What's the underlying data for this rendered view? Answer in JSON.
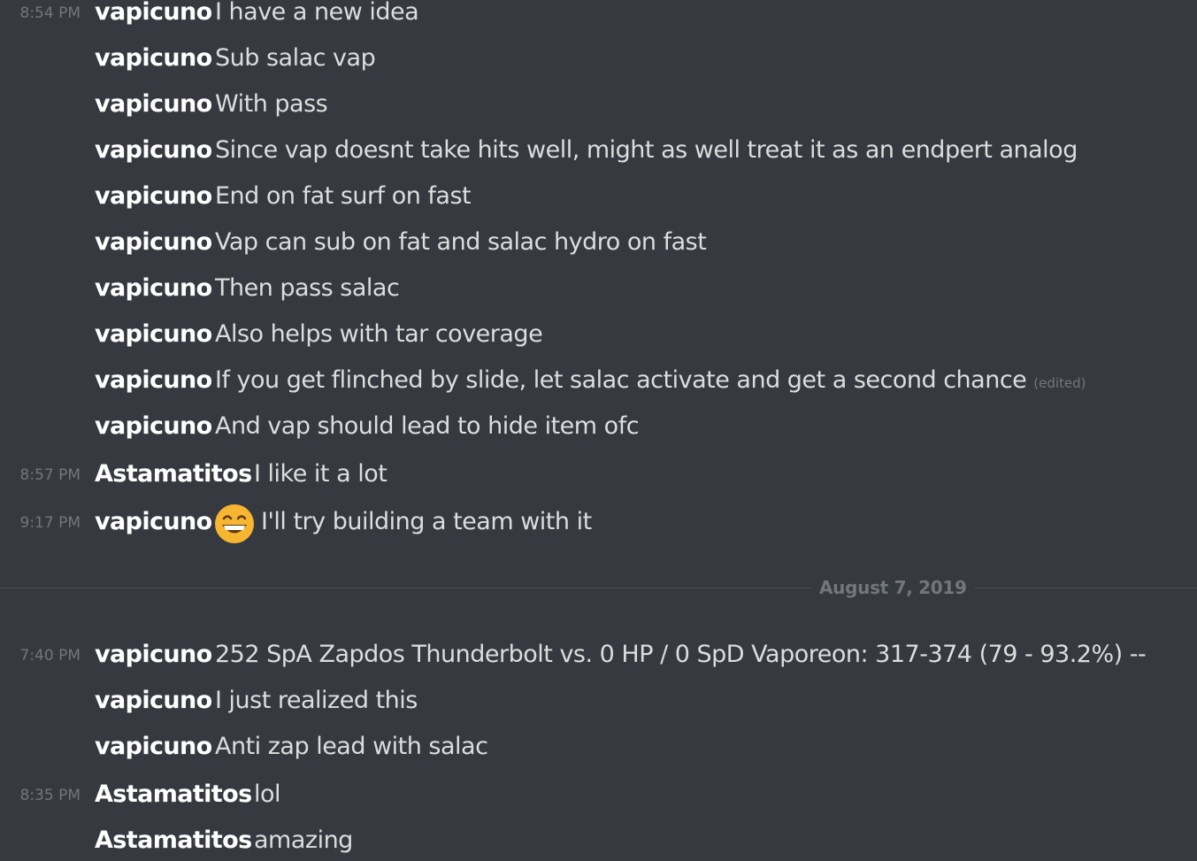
{
  "messages_before": [
    {
      "time": "8:54 PM",
      "author": "vapicuno",
      "text": "I have a new idea"
    },
    {
      "time": "",
      "author": "vapicuno",
      "text": "Sub salac vap"
    },
    {
      "time": "",
      "author": "vapicuno",
      "text": "With pass"
    },
    {
      "time": "",
      "author": "vapicuno",
      "text": "Since vap doesnt take hits well, might as well treat it as an endpert analog"
    },
    {
      "time": "",
      "author": "vapicuno",
      "text": "End on fat surf on fast"
    },
    {
      "time": "",
      "author": "vapicuno",
      "text": "Vap can sub on fat and salac hydro on fast"
    },
    {
      "time": "",
      "author": "vapicuno",
      "text": "Then pass salac"
    },
    {
      "time": "",
      "author": "vapicuno",
      "text": "Also helps with tar coverage"
    },
    {
      "time": "",
      "author": "vapicuno",
      "text": "If you get flinched by slide, let salac activate and get a second chance",
      "edited": "(edited)"
    },
    {
      "time": "",
      "author": "vapicuno",
      "text": "And vap should lead to hide item ofc"
    },
    {
      "time": "8:57 PM",
      "author": "Astamatitos",
      "text": "I like it a lot"
    },
    {
      "time": "9:17 PM",
      "author": "vapicuno",
      "text": "I'll try building a team with it",
      "emoji": "grinning-face-emoji"
    }
  ],
  "date_divider": "August 7, 2019",
  "messages_after": [
    {
      "time": "7:40 PM",
      "author": "vapicuno",
      "text": "252 SpA Zapdos Thunderbolt vs. 0 HP / 0 SpD Vaporeon: 317-374 (79 - 93.2%) --"
    },
    {
      "time": "",
      "author": "vapicuno",
      "text": "I just realized this"
    },
    {
      "time": "",
      "author": "vapicuno",
      "text": "Anti zap lead with salac"
    },
    {
      "time": "8:35 PM",
      "author": "Astamatitos",
      "text": "lol"
    },
    {
      "time": "",
      "author": "Astamatitos",
      "text": "amazing"
    }
  ],
  "colors": {
    "background": "#36393f",
    "author": "#ffffff",
    "message_text": "#dcddde",
    "muted": "#72767d",
    "emoji": "#f7b531"
  }
}
